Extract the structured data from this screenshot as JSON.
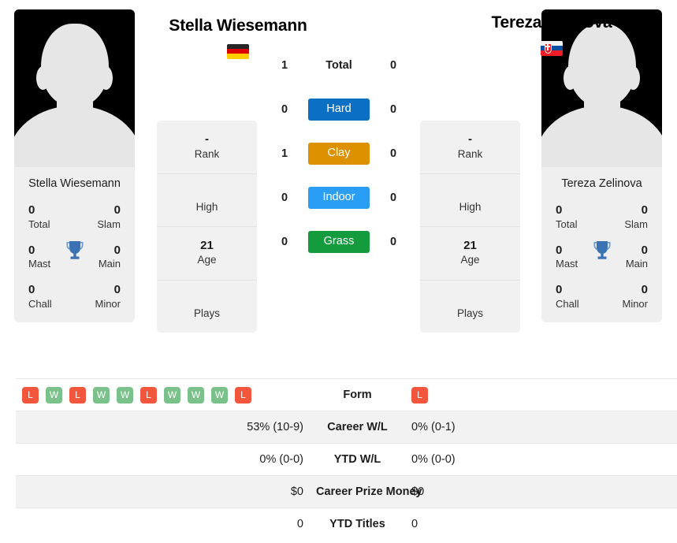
{
  "players": {
    "left": {
      "full_name": "Stella Wiesemann",
      "card_name": "Stella Wiesemann",
      "country_flag": "flag-germany",
      "titles": {
        "total_value": "0",
        "total_label": "Total",
        "slam_value": "0",
        "slam_label": "Slam",
        "mast_value": "0",
        "mast_label": "Mast",
        "main_value": "0",
        "main_label": "Main",
        "chall_value": "0",
        "chall_label": "Chall",
        "minor_value": "0",
        "minor_label": "Minor",
        "trophy_icon": "trophy-icon"
      },
      "info": {
        "rank_value": "-",
        "rank_label": "Rank",
        "high_value": "",
        "high_label": "High",
        "age_value": "21",
        "age_label": "Age",
        "plays_value": "",
        "plays_label": "Plays"
      }
    },
    "right": {
      "full_name": "Tereza Zelinova",
      "card_name": "Tereza Zelinova",
      "country_flag": "flag-slovakia",
      "titles": {
        "total_value": "0",
        "total_label": "Total",
        "slam_value": "0",
        "slam_label": "Slam",
        "mast_value": "0",
        "mast_label": "Mast",
        "main_value": "0",
        "main_label": "Main",
        "chall_value": "0",
        "chall_label": "Chall",
        "minor_value": "0",
        "minor_label": "Minor",
        "trophy_icon": "trophy-icon"
      },
      "info": {
        "rank_value": "-",
        "rank_label": "Rank",
        "high_value": "",
        "high_label": "High",
        "age_value": "21",
        "age_label": "Age",
        "plays_value": "",
        "plays_label": "Plays"
      }
    }
  },
  "surfaces": [
    {
      "label": "Total",
      "left": "1",
      "right": "0",
      "style": "plain",
      "color": ""
    },
    {
      "label": "Hard",
      "left": "0",
      "right": "0",
      "style": "badge",
      "color": "#0b6fc4"
    },
    {
      "label": "Clay",
      "left": "1",
      "right": "0",
      "style": "badge",
      "color": "#dd9100"
    },
    {
      "label": "Indoor",
      "left": "0",
      "right": "0",
      "style": "badge",
      "color": "#2a9df4"
    },
    {
      "label": "Grass",
      "left": "0",
      "right": "0",
      "style": "badge",
      "color": "#139b3e"
    }
  ],
  "comparison": {
    "form": {
      "label": "Form",
      "left_results": [
        "L",
        "W",
        "L",
        "W",
        "W",
        "L",
        "W",
        "W",
        "W",
        "L"
      ],
      "right_results": [
        "L"
      ]
    },
    "rows": [
      {
        "label": "Career W/L",
        "left": "53% (10-9)",
        "right": "0% (0-1)"
      },
      {
        "label": "YTD W/L",
        "left": "0% (0-0)",
        "right": "0% (0-0)"
      },
      {
        "label": "Career Prize Money",
        "left": "$0",
        "right": "$0"
      },
      {
        "label": "YTD Titles",
        "left": "0",
        "right": "0"
      }
    ]
  },
  "colors": {
    "win": "#7ac18b",
    "loss": "#f2563c",
    "trophy": "#3b72b4",
    "card_bg": "#f1f1f1",
    "row_shade": "#f2f2f2"
  }
}
